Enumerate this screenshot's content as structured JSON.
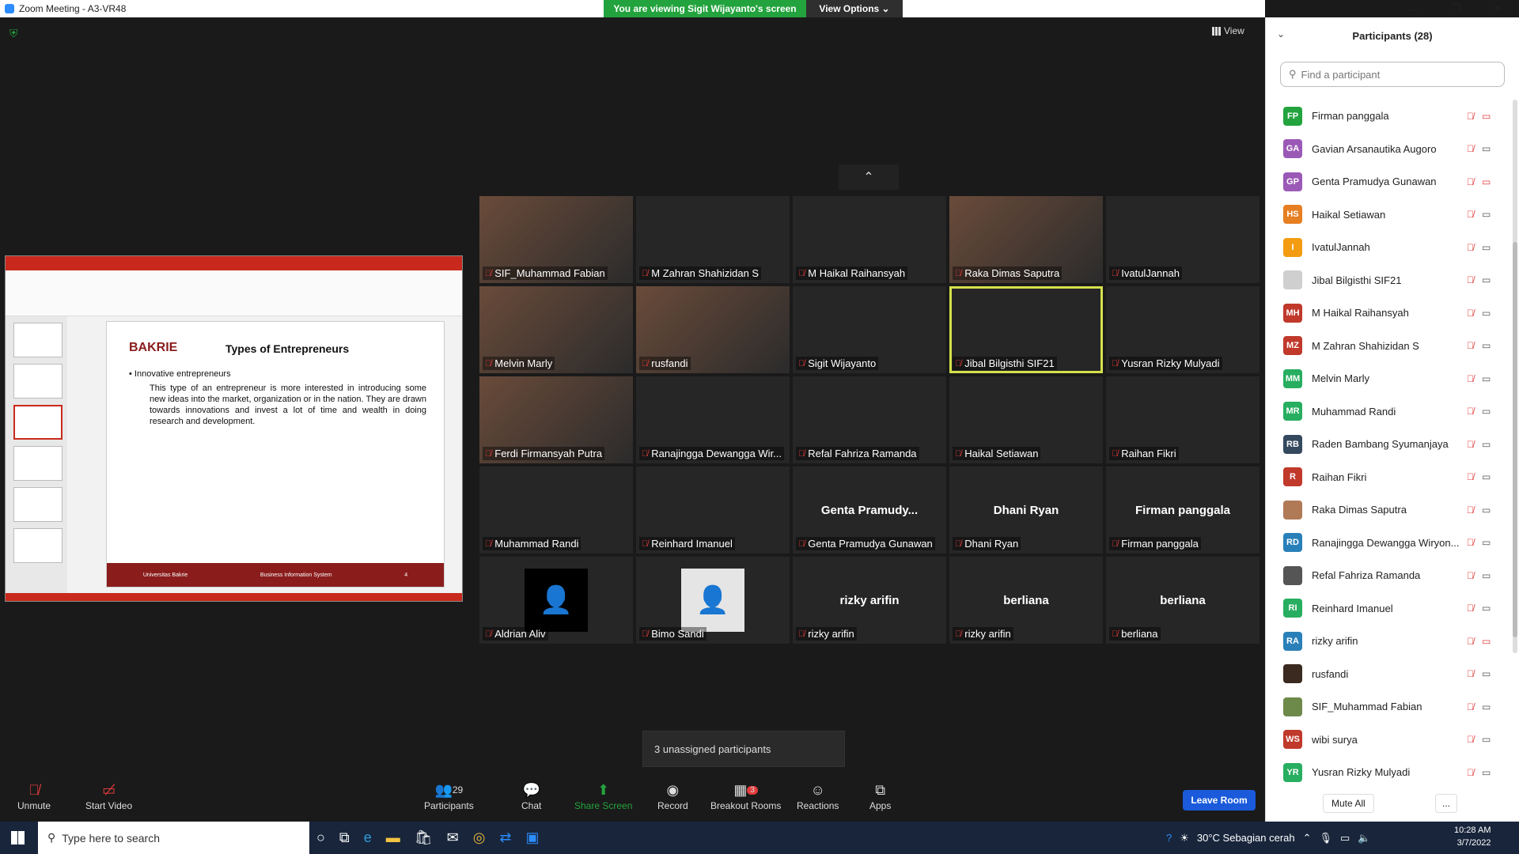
{
  "window": {
    "title": "Zoom Meeting - A3-VR48",
    "banner": "You are viewing Sigit Wijayanto's screen",
    "view_options": "View Options"
  },
  "meeting": {
    "view_label": "View",
    "unassigned_popup": "3 unassigned participants",
    "shared_slide": {
      "logo": "BAKRIE",
      "title": "Types of Entrepreneurs",
      "bullet1": "• Innovative entrepreneurs",
      "bullet2": "This type of an entrepreneur is more interested in introducing some new ideas into the market, organization or in the nation. They are drawn towards innovations and invest a lot of time and wealth in doing research and development.",
      "footer_left": "Universitas Bakrie",
      "footer_mid": "Business Information System",
      "footer_right": "4"
    },
    "tiles": [
      {
        "name": "SIF_Muhammad Fabian",
        "center": "",
        "video": true
      },
      {
        "name": "M Zahran Shahizidan S",
        "center": "",
        "video": false
      },
      {
        "name": "M Haikal Raihansyah",
        "center": "",
        "video": false
      },
      {
        "name": "Raka Dimas Saputra",
        "center": "",
        "video": true
      },
      {
        "name": "IvatulJannah",
        "center": "",
        "video": false
      },
      {
        "name": "Melvin Marly",
        "center": "",
        "video": true
      },
      {
        "name": "rusfandi",
        "center": "",
        "video": true
      },
      {
        "name": "Sigit Wijayanto",
        "center": "",
        "video": false
      },
      {
        "name": "Jibal Bilgisthi SIF21",
        "center": "",
        "video": false,
        "active": true
      },
      {
        "name": "Yusran Rizky Mulyadi",
        "center": "",
        "video": false
      },
      {
        "name": "Ferdi Firmansyah Putra",
        "center": "",
        "video": true
      },
      {
        "name": "Ranajingga Dewangga Wir...",
        "center": "",
        "video": false
      },
      {
        "name": "Refal Fahriza Ramanda",
        "center": "",
        "video": false
      },
      {
        "name": "Haikal Setiawan",
        "center": "",
        "video": false
      },
      {
        "name": "Raihan Fikri",
        "center": "",
        "video": false
      },
      {
        "name": "Muhammad Randi",
        "center": "",
        "video": false
      },
      {
        "name": "Reinhard Imanuel",
        "center": "",
        "video": false
      },
      {
        "name": "Genta Pramudya Gunawan",
        "center": "Genta Pramudy...",
        "video": false
      },
      {
        "name": "Dhani Ryan",
        "center": "Dhani Ryan",
        "video": false
      },
      {
        "name": "Firman panggala",
        "center": "Firman panggala",
        "video": false
      },
      {
        "name": "Aldrian Aliv",
        "center": "",
        "video": false,
        "avatar": "dark"
      },
      {
        "name": "Bimo Sandi",
        "center": "",
        "video": false,
        "avatar": "light"
      },
      {
        "name": "rizky arifin",
        "center": "rizky arifin",
        "video": false
      },
      {
        "name": "rizky arifin",
        "center": "berliana",
        "video": false
      },
      {
        "name": "berliana",
        "center": "berliana",
        "video": false
      }
    ]
  },
  "toolbar": {
    "unmute": "Unmute",
    "start_video": "Start Video",
    "participants": "Participants",
    "participants_count": "29",
    "chat": "Chat",
    "share_screen": "Share Screen",
    "record": "Record",
    "breakout_rooms": "Breakout Rooms",
    "breakout_badge": "3",
    "reactions": "Reactions",
    "apps": "Apps",
    "leave": "Leave Room"
  },
  "panel": {
    "title": "Participants (28)",
    "search_placeholder": "Find a participant",
    "mute_all": "Mute All",
    "more": "...",
    "participants": [
      {
        "initials": "FP",
        "name": "Firman panggala",
        "color": "#23a33d",
        "cam_off": true
      },
      {
        "initials": "GA",
        "name": "Gavian Arsanautika Augoro",
        "color": "#9b59b6",
        "cam_off": false
      },
      {
        "initials": "GP",
        "name": "Genta Pramudya Gunawan",
        "color": "#9b59b6",
        "cam_off": true
      },
      {
        "initials": "HS",
        "name": "Haikal Setiawan",
        "color": "#e67e22",
        "cam_off": false
      },
      {
        "initials": "I",
        "name": "IvatulJannah",
        "color": "#f39c12",
        "cam_off": false
      },
      {
        "initials": "",
        "name": "Jibal Bilgisthi SIF21",
        "color": "#cfcfcf",
        "cam_off": false
      },
      {
        "initials": "MH",
        "name": "M Haikal Raihansyah",
        "color": "#c0392b",
        "cam_off": false
      },
      {
        "initials": "MZ",
        "name": "M Zahran Shahizidan S",
        "color": "#c0392b",
        "cam_off": false
      },
      {
        "initials": "MM",
        "name": "Melvin Marly",
        "color": "#27ae60",
        "cam_off": false
      },
      {
        "initials": "MR",
        "name": "Muhammad Randi",
        "color": "#27ae60",
        "cam_off": false
      },
      {
        "initials": "RB",
        "name": "Raden Bambang Syumanjaya",
        "color": "#34495e",
        "cam_off": false
      },
      {
        "initials": "R",
        "name": "Raihan Fikri",
        "color": "#c0392b",
        "cam_off": false
      },
      {
        "initials": "",
        "name": "Raka Dimas Saputra",
        "color": "#b07a57",
        "cam_off": false
      },
      {
        "initials": "RD",
        "name": "Ranajingga Dewangga Wiryon...",
        "color": "#2980b9",
        "cam_off": false
      },
      {
        "initials": "",
        "name": "Refal Fahriza Ramanda",
        "color": "#555555",
        "cam_off": false
      },
      {
        "initials": "RI",
        "name": "Reinhard Imanuel",
        "color": "#27ae60",
        "cam_off": false
      },
      {
        "initials": "RA",
        "name": "rizky arifin",
        "color": "#2980b9",
        "cam_off": true
      },
      {
        "initials": "",
        "name": "rusfandi",
        "color": "#3b2a20",
        "cam_off": false
      },
      {
        "initials": "",
        "name": "SIF_Muhammad Fabian",
        "color": "#6d8a4a",
        "cam_off": false
      },
      {
        "initials": "WS",
        "name": "wibi surya",
        "color": "#c0392b",
        "cam_off": false
      },
      {
        "initials": "YR",
        "name": "Yusran Rizky Mulyadi",
        "color": "#27ae60",
        "cam_off": false
      }
    ]
  },
  "taskbar": {
    "search_placeholder": "Type here to search",
    "weather": "30°C  Sebagian cerah",
    "time": "10:28 AM",
    "date": "3/7/2022"
  }
}
